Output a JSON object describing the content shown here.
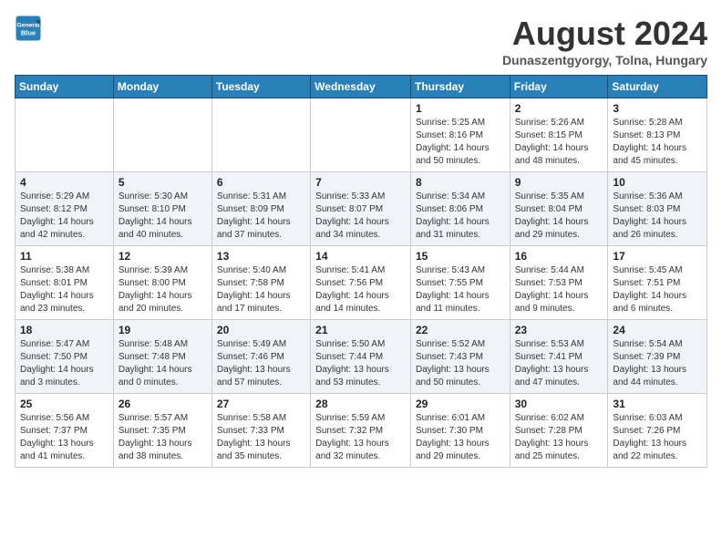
{
  "header": {
    "logo_line1": "General",
    "logo_line2": "Blue",
    "title": "August 2024",
    "subtitle": "Dunaszentgyorgy, Tolna, Hungary"
  },
  "weekdays": [
    "Sunday",
    "Monday",
    "Tuesday",
    "Wednesday",
    "Thursday",
    "Friday",
    "Saturday"
  ],
  "weeks": [
    [
      {
        "day": "",
        "info": ""
      },
      {
        "day": "",
        "info": ""
      },
      {
        "day": "",
        "info": ""
      },
      {
        "day": "",
        "info": ""
      },
      {
        "day": "1",
        "info": "Sunrise: 5:25 AM\nSunset: 8:16 PM\nDaylight: 14 hours\nand 50 minutes."
      },
      {
        "day": "2",
        "info": "Sunrise: 5:26 AM\nSunset: 8:15 PM\nDaylight: 14 hours\nand 48 minutes."
      },
      {
        "day": "3",
        "info": "Sunrise: 5:28 AM\nSunset: 8:13 PM\nDaylight: 14 hours\nand 45 minutes."
      }
    ],
    [
      {
        "day": "4",
        "info": "Sunrise: 5:29 AM\nSunset: 8:12 PM\nDaylight: 14 hours\nand 42 minutes."
      },
      {
        "day": "5",
        "info": "Sunrise: 5:30 AM\nSunset: 8:10 PM\nDaylight: 14 hours\nand 40 minutes."
      },
      {
        "day": "6",
        "info": "Sunrise: 5:31 AM\nSunset: 8:09 PM\nDaylight: 14 hours\nand 37 minutes."
      },
      {
        "day": "7",
        "info": "Sunrise: 5:33 AM\nSunset: 8:07 PM\nDaylight: 14 hours\nand 34 minutes."
      },
      {
        "day": "8",
        "info": "Sunrise: 5:34 AM\nSunset: 8:06 PM\nDaylight: 14 hours\nand 31 minutes."
      },
      {
        "day": "9",
        "info": "Sunrise: 5:35 AM\nSunset: 8:04 PM\nDaylight: 14 hours\nand 29 minutes."
      },
      {
        "day": "10",
        "info": "Sunrise: 5:36 AM\nSunset: 8:03 PM\nDaylight: 14 hours\nand 26 minutes."
      }
    ],
    [
      {
        "day": "11",
        "info": "Sunrise: 5:38 AM\nSunset: 8:01 PM\nDaylight: 14 hours\nand 23 minutes."
      },
      {
        "day": "12",
        "info": "Sunrise: 5:39 AM\nSunset: 8:00 PM\nDaylight: 14 hours\nand 20 minutes."
      },
      {
        "day": "13",
        "info": "Sunrise: 5:40 AM\nSunset: 7:58 PM\nDaylight: 14 hours\nand 17 minutes."
      },
      {
        "day": "14",
        "info": "Sunrise: 5:41 AM\nSunset: 7:56 PM\nDaylight: 14 hours\nand 14 minutes."
      },
      {
        "day": "15",
        "info": "Sunrise: 5:43 AM\nSunset: 7:55 PM\nDaylight: 14 hours\nand 11 minutes."
      },
      {
        "day": "16",
        "info": "Sunrise: 5:44 AM\nSunset: 7:53 PM\nDaylight: 14 hours\nand 9 minutes."
      },
      {
        "day": "17",
        "info": "Sunrise: 5:45 AM\nSunset: 7:51 PM\nDaylight: 14 hours\nand 6 minutes."
      }
    ],
    [
      {
        "day": "18",
        "info": "Sunrise: 5:47 AM\nSunset: 7:50 PM\nDaylight: 14 hours\nand 3 minutes."
      },
      {
        "day": "19",
        "info": "Sunrise: 5:48 AM\nSunset: 7:48 PM\nDaylight: 14 hours\nand 0 minutes."
      },
      {
        "day": "20",
        "info": "Sunrise: 5:49 AM\nSunset: 7:46 PM\nDaylight: 13 hours\nand 57 minutes."
      },
      {
        "day": "21",
        "info": "Sunrise: 5:50 AM\nSunset: 7:44 PM\nDaylight: 13 hours\nand 53 minutes."
      },
      {
        "day": "22",
        "info": "Sunrise: 5:52 AM\nSunset: 7:43 PM\nDaylight: 13 hours\nand 50 minutes."
      },
      {
        "day": "23",
        "info": "Sunrise: 5:53 AM\nSunset: 7:41 PM\nDaylight: 13 hours\nand 47 minutes."
      },
      {
        "day": "24",
        "info": "Sunrise: 5:54 AM\nSunset: 7:39 PM\nDaylight: 13 hours\nand 44 minutes."
      }
    ],
    [
      {
        "day": "25",
        "info": "Sunrise: 5:56 AM\nSunset: 7:37 PM\nDaylight: 13 hours\nand 41 minutes."
      },
      {
        "day": "26",
        "info": "Sunrise: 5:57 AM\nSunset: 7:35 PM\nDaylight: 13 hours\nand 38 minutes."
      },
      {
        "day": "27",
        "info": "Sunrise: 5:58 AM\nSunset: 7:33 PM\nDaylight: 13 hours\nand 35 minutes."
      },
      {
        "day": "28",
        "info": "Sunrise: 5:59 AM\nSunset: 7:32 PM\nDaylight: 13 hours\nand 32 minutes."
      },
      {
        "day": "29",
        "info": "Sunrise: 6:01 AM\nSunset: 7:30 PM\nDaylight: 13 hours\nand 29 minutes."
      },
      {
        "day": "30",
        "info": "Sunrise: 6:02 AM\nSunset: 7:28 PM\nDaylight: 13 hours\nand 25 minutes."
      },
      {
        "day": "31",
        "info": "Sunrise: 6:03 AM\nSunset: 7:26 PM\nDaylight: 13 hours\nand 22 minutes."
      }
    ]
  ]
}
